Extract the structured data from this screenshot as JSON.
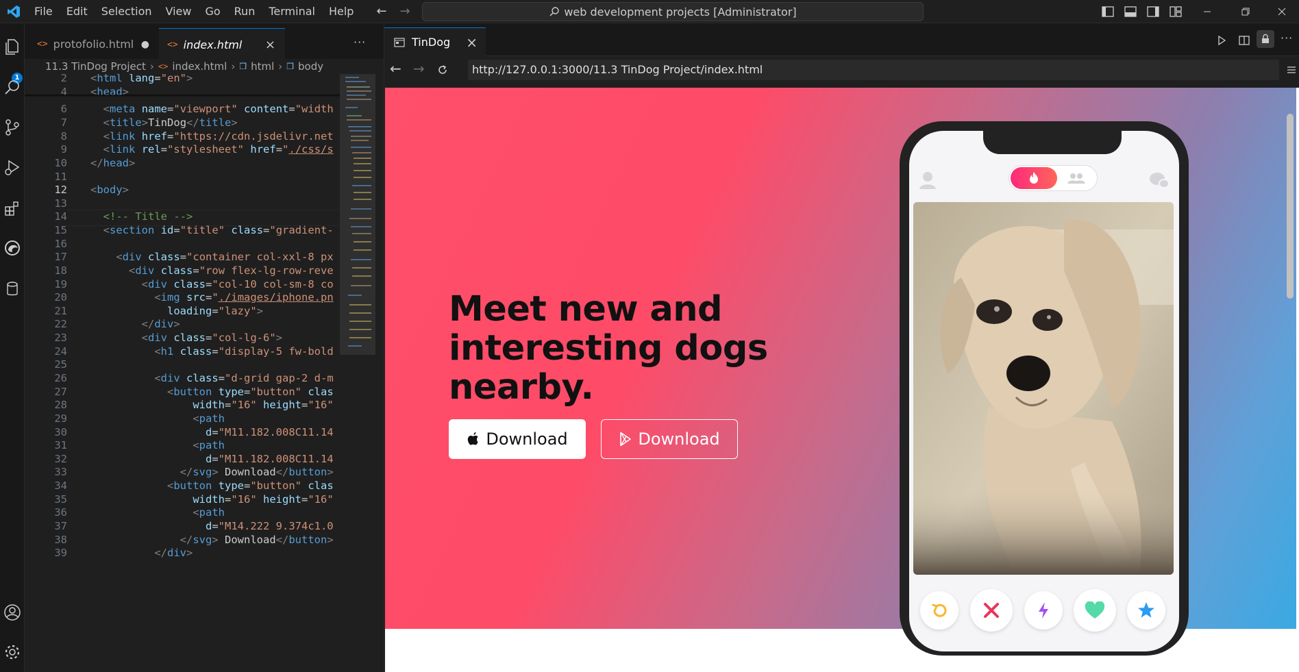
{
  "titlebar": {
    "menu": [
      "File",
      "Edit",
      "Selection",
      "View",
      "Go",
      "Run",
      "Terminal",
      "Help"
    ],
    "command_center": "web development projects [Administrator]"
  },
  "activity_bar": {
    "explorer_badge": "1"
  },
  "editor": {
    "tabs": [
      {
        "label": "protofolio.html",
        "state": "modified"
      },
      {
        "label": "index.html",
        "state": "active"
      }
    ],
    "breadcrumb": [
      "11.3 TinDog Project",
      "index.html",
      "html",
      "body"
    ],
    "active_line": "12"
  },
  "browser": {
    "tab_title": "TinDog",
    "url": "http://127.0.0.1:3000/11.3 TinDog Project/index.html"
  },
  "webpage": {
    "heading": "Meet new and interesting dogs nearby.",
    "apple_button": "Download",
    "google_button": "Download"
  },
  "colors": {
    "accent": "#0078d4",
    "hero_pink": "#ff4f6a",
    "hero_blue": "#3aa9e2"
  }
}
